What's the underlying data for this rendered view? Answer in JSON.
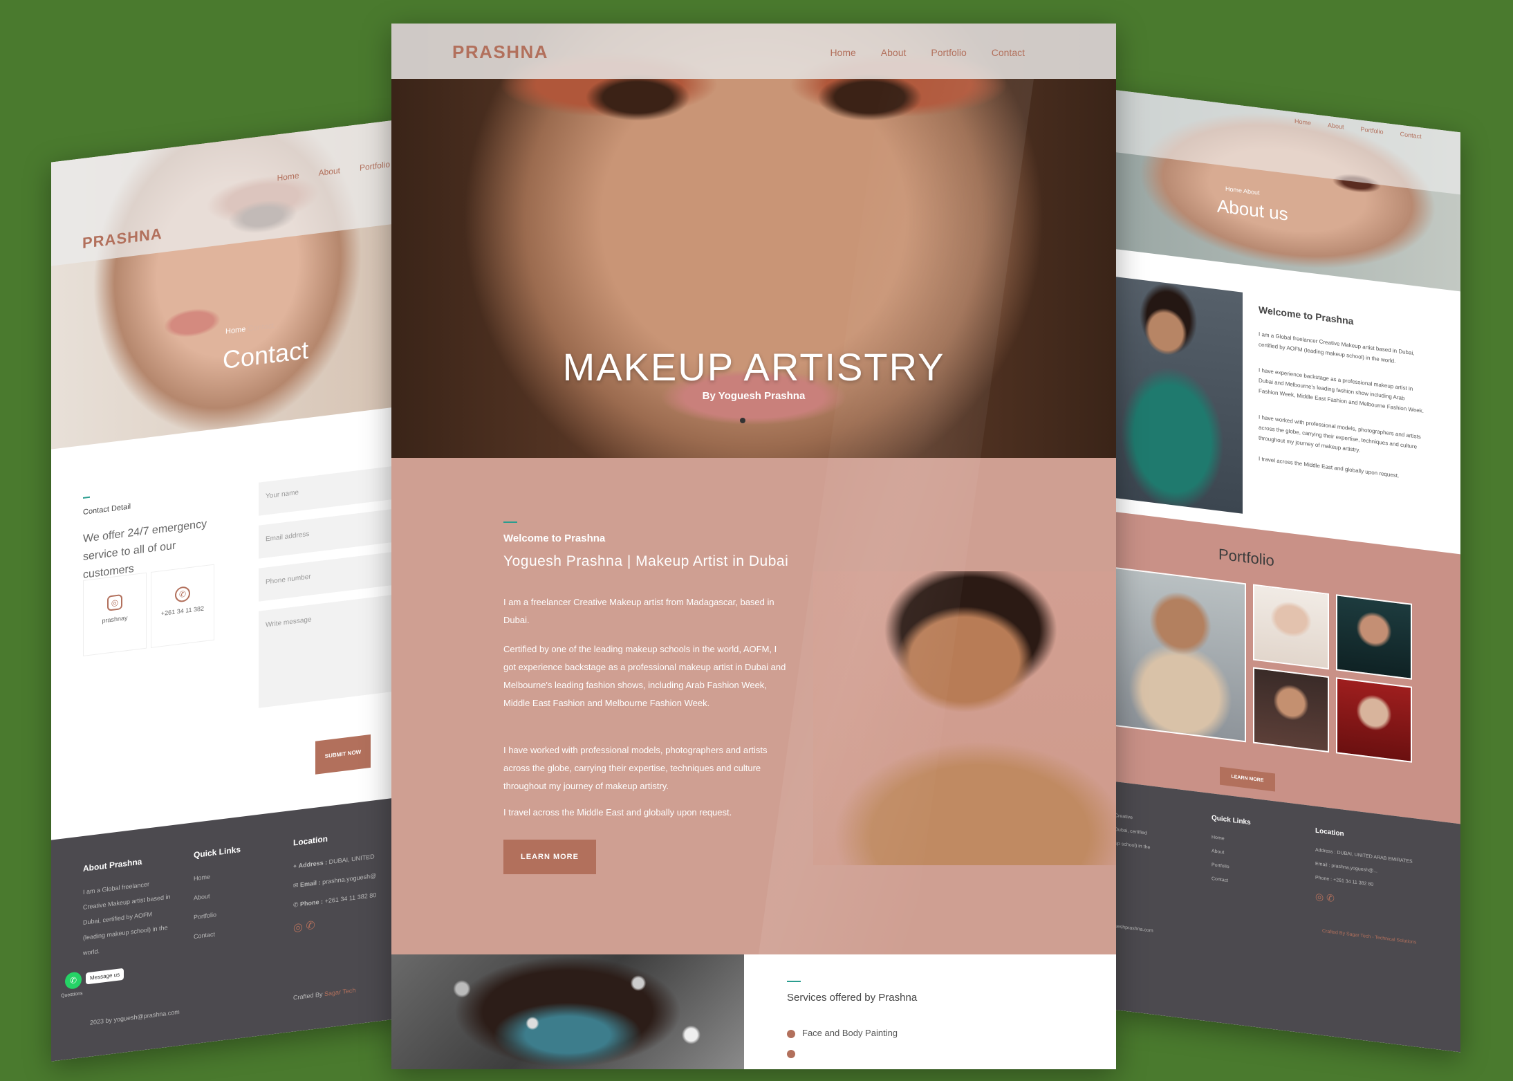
{
  "brand": "PRASHNA",
  "nav": [
    "Home",
    "About",
    "Portfolio",
    "Contact"
  ],
  "colors": {
    "accent": "#b2705c",
    "panel_bg": "#cf9f92",
    "footer_bg": "#4c4a4f",
    "teal": "#2a9d8f",
    "background": "#4a7a2e"
  },
  "center": {
    "headline": "MAKEUP ARTISTRY",
    "byline": "By Yoguesh Prashna",
    "welcome": "Welcome to Prashna",
    "subhead": "Yoguesh Prashna | Makeup Artist in Dubai",
    "paragraphs": [
      "I am a freelancer Creative Makeup artist from Madagascar, based in Dubai.",
      "Certified by one of the leading makeup schools in the world, AOFM, I got experience backstage as a professional makeup artist in Dubai and Melbourne's leading fashion shows, including Arab Fashion Week, Middle East Fashion and Melbourne Fashion Week.",
      "I have worked with professional models, photographers and artists across the globe, carrying their expertise, techniques and culture throughout my journey of makeup artistry.",
      "I travel across the Middle East and globally upon request."
    ],
    "learn_more": "LEARN MORE",
    "services_title": "Services offered by Prashna",
    "services": [
      "Face and Body Painting"
    ]
  },
  "left": {
    "logo": "PRASHNA",
    "menu": [
      "Home",
      "About",
      "Portfolio"
    ],
    "breadcrumb": {
      "home": "Home",
      "current": "Contact"
    },
    "title": "Contact",
    "section_label": "Contact Detail",
    "tagline": "We offer 24/7 emergency service to all of our customers",
    "socials": [
      {
        "icon": "instagram-icon",
        "label": "prashnay"
      },
      {
        "icon": "whatsapp-icon",
        "label": "+261 34 11 382"
      }
    ],
    "form": {
      "name_placeholder": "Your name",
      "email_placeholder": "Email address",
      "phone_placeholder": "Phone number",
      "message_placeholder": "Write message",
      "submit": "SUBMIT NOW"
    },
    "footer": {
      "about_title": "About Prashna",
      "about_text": "I am a Global freelancer Creative Makeup artist based in Dubai, certified by AOFM (leading makeup school) in the world.",
      "links_title": "Quick Links",
      "links": [
        "Home",
        "About",
        "Portfolio",
        "Contact"
      ],
      "location_title": "Location",
      "address_label": "Address :",
      "address": "DUBAI, UNITED",
      "email_label": "Email :",
      "email": "prashna.yoguesh@",
      "phone_label": "Phone :",
      "phone": "+261 34 11 382 80",
      "copyright": "2023 by yoguesh@prashna.com",
      "crafted": "Crafted By",
      "crafted_by": "Sagar Tech",
      "whatsapp_msg": "Message us",
      "whatsapp_caption": "Questions"
    }
  },
  "right": {
    "menu": [
      "Home",
      "About",
      "Portfolio",
      "Contact"
    ],
    "breadcrumb": {
      "home": "Home",
      "current": "About"
    },
    "title": "About us",
    "welcome": "Welcome to Prashna",
    "paragraphs": [
      "I am a Global freelancer Creative Makeup artist based in Dubai, certified by AOFM (leading makeup school) in the world.",
      "I have experience backstage as a professional makeup artist in Dubai and Melbourne's leading fashion show including Arab Fashion Week, Middle East Fashion and Melbourne Fashion Week.",
      "I have worked with professional models, photographers and artists across the globe, carrying their expertise, techniques and culture throughout my journey of makeup artistry.",
      "I travel across the Middle East and globally upon request."
    ],
    "portfolio_title": "Portfolio",
    "learn_more": "LEARN MORE",
    "footer": {
      "about_fragment": [
        "Creative",
        "Dubai, certified",
        "up school) in the"
      ],
      "links_title": "Quick Links",
      "links": [
        "Home",
        "About",
        "Portfolio",
        "Contact"
      ],
      "location_title": "Location",
      "address": "Address : DUBAI, UNITED ARAB EMIRATES",
      "email": "Email : prashna.yoguesh@...",
      "phone": "Phone : +261 34 11 382 80",
      "copyright": "ueshprashna.com",
      "crafted": "Crafted By Sagar Tech - Technical Solutions"
    }
  }
}
